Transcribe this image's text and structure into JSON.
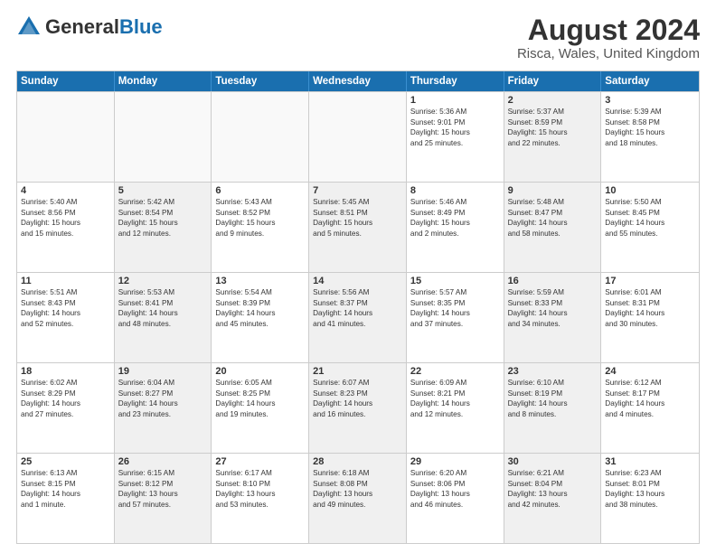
{
  "header": {
    "logo_general": "General",
    "logo_blue": "Blue",
    "month_title": "August 2024",
    "location": "Risca, Wales, United Kingdom"
  },
  "days_of_week": [
    "Sunday",
    "Monday",
    "Tuesday",
    "Wednesday",
    "Thursday",
    "Friday",
    "Saturday"
  ],
  "rows": [
    [
      {
        "day": "",
        "lines": [],
        "empty": true
      },
      {
        "day": "",
        "lines": [],
        "empty": true
      },
      {
        "day": "",
        "lines": [],
        "empty": true
      },
      {
        "day": "",
        "lines": [],
        "empty": true
      },
      {
        "day": "1",
        "lines": [
          "Sunrise: 5:36 AM",
          "Sunset: 9:01 PM",
          "Daylight: 15 hours",
          "and 25 minutes."
        ]
      },
      {
        "day": "2",
        "lines": [
          "Sunrise: 5:37 AM",
          "Sunset: 8:59 PM",
          "Daylight: 15 hours",
          "and 22 minutes."
        ],
        "shaded": true
      },
      {
        "day": "3",
        "lines": [
          "Sunrise: 5:39 AM",
          "Sunset: 8:58 PM",
          "Daylight: 15 hours",
          "and 18 minutes."
        ]
      }
    ],
    [
      {
        "day": "4",
        "lines": [
          "Sunrise: 5:40 AM",
          "Sunset: 8:56 PM",
          "Daylight: 15 hours",
          "and 15 minutes."
        ]
      },
      {
        "day": "5",
        "lines": [
          "Sunrise: 5:42 AM",
          "Sunset: 8:54 PM",
          "Daylight: 15 hours",
          "and 12 minutes."
        ],
        "shaded": true
      },
      {
        "day": "6",
        "lines": [
          "Sunrise: 5:43 AM",
          "Sunset: 8:52 PM",
          "Daylight: 15 hours",
          "and 9 minutes."
        ]
      },
      {
        "day": "7",
        "lines": [
          "Sunrise: 5:45 AM",
          "Sunset: 8:51 PM",
          "Daylight: 15 hours",
          "and 5 minutes."
        ],
        "shaded": true
      },
      {
        "day": "8",
        "lines": [
          "Sunrise: 5:46 AM",
          "Sunset: 8:49 PM",
          "Daylight: 15 hours",
          "and 2 minutes."
        ]
      },
      {
        "day": "9",
        "lines": [
          "Sunrise: 5:48 AM",
          "Sunset: 8:47 PM",
          "Daylight: 14 hours",
          "and 58 minutes."
        ],
        "shaded": true
      },
      {
        "day": "10",
        "lines": [
          "Sunrise: 5:50 AM",
          "Sunset: 8:45 PM",
          "Daylight: 14 hours",
          "and 55 minutes."
        ]
      }
    ],
    [
      {
        "day": "11",
        "lines": [
          "Sunrise: 5:51 AM",
          "Sunset: 8:43 PM",
          "Daylight: 14 hours",
          "and 52 minutes."
        ]
      },
      {
        "day": "12",
        "lines": [
          "Sunrise: 5:53 AM",
          "Sunset: 8:41 PM",
          "Daylight: 14 hours",
          "and 48 minutes."
        ],
        "shaded": true
      },
      {
        "day": "13",
        "lines": [
          "Sunrise: 5:54 AM",
          "Sunset: 8:39 PM",
          "Daylight: 14 hours",
          "and 45 minutes."
        ]
      },
      {
        "day": "14",
        "lines": [
          "Sunrise: 5:56 AM",
          "Sunset: 8:37 PM",
          "Daylight: 14 hours",
          "and 41 minutes."
        ],
        "shaded": true
      },
      {
        "day": "15",
        "lines": [
          "Sunrise: 5:57 AM",
          "Sunset: 8:35 PM",
          "Daylight: 14 hours",
          "and 37 minutes."
        ]
      },
      {
        "day": "16",
        "lines": [
          "Sunrise: 5:59 AM",
          "Sunset: 8:33 PM",
          "Daylight: 14 hours",
          "and 34 minutes."
        ],
        "shaded": true
      },
      {
        "day": "17",
        "lines": [
          "Sunrise: 6:01 AM",
          "Sunset: 8:31 PM",
          "Daylight: 14 hours",
          "and 30 minutes."
        ]
      }
    ],
    [
      {
        "day": "18",
        "lines": [
          "Sunrise: 6:02 AM",
          "Sunset: 8:29 PM",
          "Daylight: 14 hours",
          "and 27 minutes."
        ]
      },
      {
        "day": "19",
        "lines": [
          "Sunrise: 6:04 AM",
          "Sunset: 8:27 PM",
          "Daylight: 14 hours",
          "and 23 minutes."
        ],
        "shaded": true
      },
      {
        "day": "20",
        "lines": [
          "Sunrise: 6:05 AM",
          "Sunset: 8:25 PM",
          "Daylight: 14 hours",
          "and 19 minutes."
        ]
      },
      {
        "day": "21",
        "lines": [
          "Sunrise: 6:07 AM",
          "Sunset: 8:23 PM",
          "Daylight: 14 hours",
          "and 16 minutes."
        ],
        "shaded": true
      },
      {
        "day": "22",
        "lines": [
          "Sunrise: 6:09 AM",
          "Sunset: 8:21 PM",
          "Daylight: 14 hours",
          "and 12 minutes."
        ]
      },
      {
        "day": "23",
        "lines": [
          "Sunrise: 6:10 AM",
          "Sunset: 8:19 PM",
          "Daylight: 14 hours",
          "and 8 minutes."
        ],
        "shaded": true
      },
      {
        "day": "24",
        "lines": [
          "Sunrise: 6:12 AM",
          "Sunset: 8:17 PM",
          "Daylight: 14 hours",
          "and 4 minutes."
        ]
      }
    ],
    [
      {
        "day": "25",
        "lines": [
          "Sunrise: 6:13 AM",
          "Sunset: 8:15 PM",
          "Daylight: 14 hours",
          "and 1 minute."
        ]
      },
      {
        "day": "26",
        "lines": [
          "Sunrise: 6:15 AM",
          "Sunset: 8:12 PM",
          "Daylight: 13 hours",
          "and 57 minutes."
        ],
        "shaded": true
      },
      {
        "day": "27",
        "lines": [
          "Sunrise: 6:17 AM",
          "Sunset: 8:10 PM",
          "Daylight: 13 hours",
          "and 53 minutes."
        ]
      },
      {
        "day": "28",
        "lines": [
          "Sunrise: 6:18 AM",
          "Sunset: 8:08 PM",
          "Daylight: 13 hours",
          "and 49 minutes."
        ],
        "shaded": true
      },
      {
        "day": "29",
        "lines": [
          "Sunrise: 6:20 AM",
          "Sunset: 8:06 PM",
          "Daylight: 13 hours",
          "and 46 minutes."
        ]
      },
      {
        "day": "30",
        "lines": [
          "Sunrise: 6:21 AM",
          "Sunset: 8:04 PM",
          "Daylight: 13 hours",
          "and 42 minutes."
        ],
        "shaded": true
      },
      {
        "day": "31",
        "lines": [
          "Sunrise: 6:23 AM",
          "Sunset: 8:01 PM",
          "Daylight: 13 hours",
          "and 38 minutes."
        ]
      }
    ]
  ]
}
